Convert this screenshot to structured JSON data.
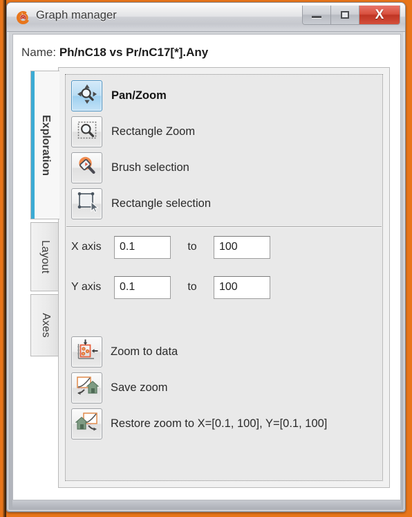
{
  "window": {
    "title": "Graph manager",
    "app_icon": "spiral-logo-icon",
    "controls": {
      "minimize": "minimize-icon",
      "maximize": "maximize-icon",
      "close": "X"
    },
    "accent_color": "#e8751a",
    "close_color": "#bf3524",
    "selection_color": "#3cabd4"
  },
  "name_row": {
    "label": "Name:",
    "value": "Ph/nC18 vs Pr/nC17[*].Any"
  },
  "tabs": [
    {
      "id": "exploration",
      "label": "Exploration",
      "active": true
    },
    {
      "id": "layout",
      "label": "Layout",
      "active": false
    },
    {
      "id": "axes",
      "label": "Axes",
      "active": false
    }
  ],
  "tools": [
    {
      "id": "pan-zoom",
      "label": "Pan/Zoom",
      "icon": "pan-zoom-icon",
      "selected": true
    },
    {
      "id": "rectangle-zoom",
      "label": "Rectangle Zoom",
      "icon": "rectangle-zoom-icon",
      "selected": false
    },
    {
      "id": "brush-selection",
      "label": "Brush selection",
      "icon": "brush-selection-icon",
      "selected": false
    },
    {
      "id": "rectangle-selection",
      "label": "Rectangle selection",
      "icon": "rectangle-selection-icon",
      "selected": false
    }
  ],
  "axes": {
    "x": {
      "label": "X axis",
      "min": "0.1",
      "to": "to",
      "max": "100"
    },
    "y": {
      "label": "Y axis",
      "min": "0.1",
      "to": "to",
      "max": "100"
    }
  },
  "actions": [
    {
      "id": "zoom-to-data",
      "label": "Zoom to data",
      "icon": "zoom-to-data-icon"
    },
    {
      "id": "save-zoom",
      "label": "Save zoom",
      "icon": "save-zoom-icon"
    },
    {
      "id": "restore-zoom",
      "label": "Restore zoom to X=[0.1, 100], Y=[0.1, 100]",
      "icon": "restore-zoom-icon"
    }
  ]
}
